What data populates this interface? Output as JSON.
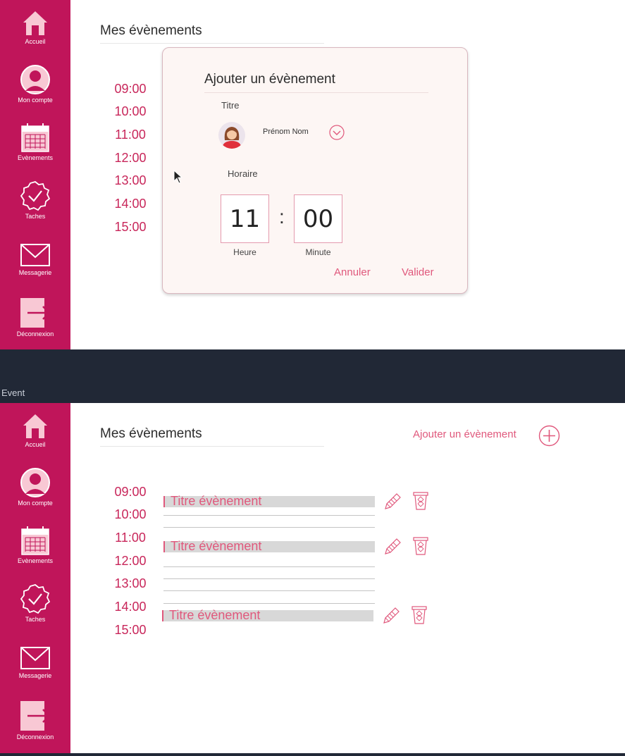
{
  "colors": {
    "sidebar": "#c0155a",
    "accent": "#e0587c",
    "time_text": "#c8265a",
    "background_dark": "#212836"
  },
  "sidebar": {
    "items": [
      {
        "label": "Accueil",
        "icon": "home-icon"
      },
      {
        "label": "Mon compte",
        "icon": "user-icon"
      },
      {
        "label": "Evènements",
        "icon": "calendar-icon"
      },
      {
        "label": "Taches",
        "icon": "check-badge-icon"
      },
      {
        "label": "Messagerie",
        "icon": "mail-icon"
      },
      {
        "label": "Déconnexion",
        "icon": "logout-icon"
      }
    ]
  },
  "frame_label": "Event",
  "screen1": {
    "title": "Mes évènements",
    "times": [
      "09:00",
      "10:00",
      "11:00",
      "12:00",
      "13:00",
      "14:00",
      "15:00"
    ],
    "modal": {
      "title": "Ajouter un évènement",
      "titre_label": "Titre",
      "person_name": "Prénom Nom",
      "horaire_label": "Horaire",
      "hour_value": "11",
      "separator": ":",
      "minute_value": "00",
      "hour_label": "Heure",
      "minute_label": "Minute",
      "cancel_label": "Annuler",
      "confirm_label": "Valider"
    }
  },
  "screen2": {
    "title": "Mes évènements",
    "add_label": "Ajouter un évènement",
    "times": [
      "09:00",
      "10:00",
      "11:00",
      "12:00",
      "13:00",
      "14:00",
      "15:00"
    ],
    "events": [
      {
        "title": "Titre évènement"
      },
      {
        "title": "Titre évènement"
      },
      {
        "title": "Titre évènement"
      }
    ]
  }
}
